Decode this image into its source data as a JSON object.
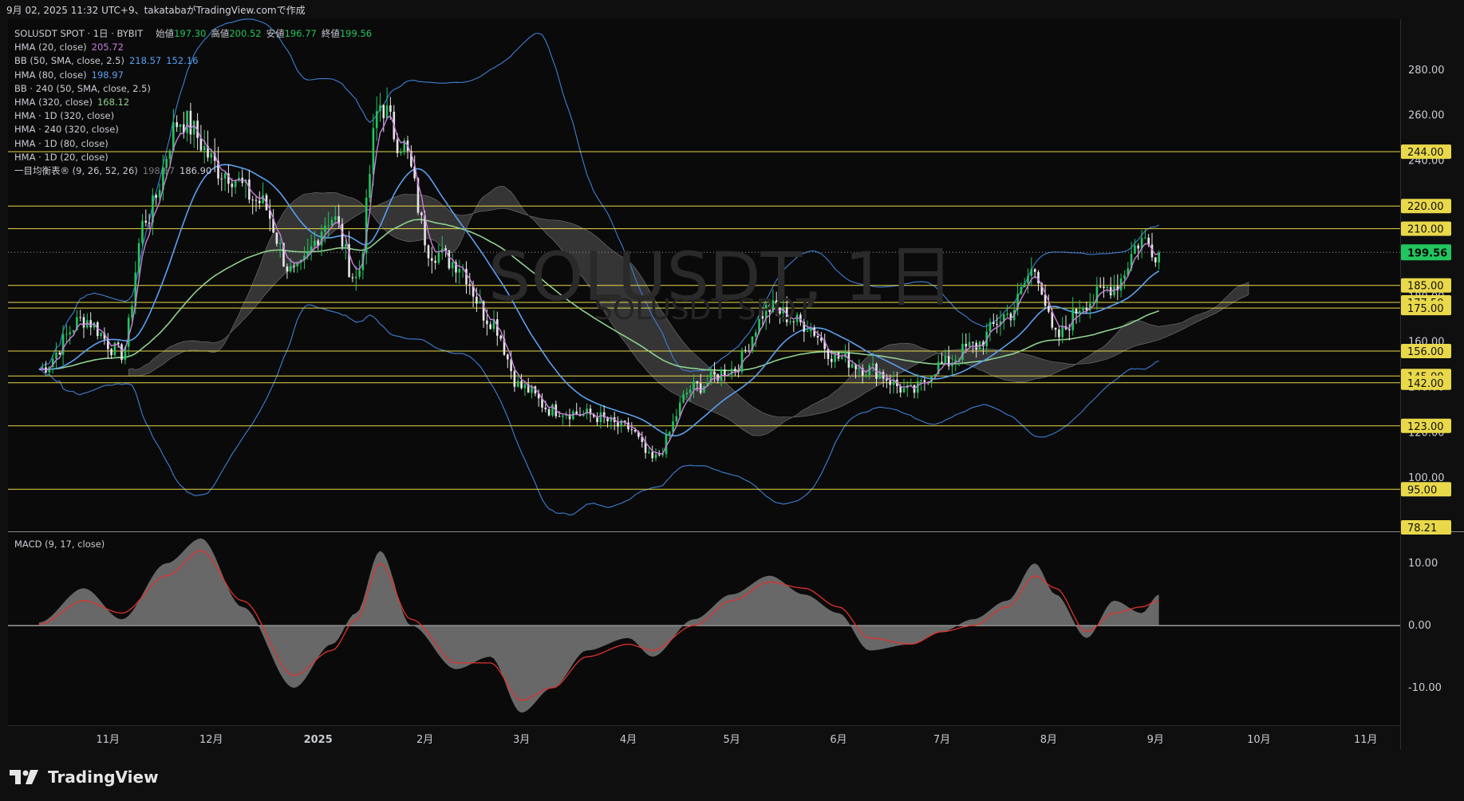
{
  "header": {
    "caption": "9月 02, 2025 11:32 UTC+9、takatabaがTradingView.comで作成"
  },
  "legend": {
    "symbol_line": "SOLUSDT SPOT · 1日 · BYBIT",
    "ohlc": {
      "open_label": "始値",
      "open": "197.30",
      "high_label": "高値",
      "high": "200.52",
      "low_label": "安値",
      "low": "196.77",
      "close_label": "終値",
      "close": "199.56"
    },
    "indicators": [
      {
        "label": "HMA (20, close)",
        "values": [
          "205.72"
        ],
        "colors": [
          "#c77ddb"
        ]
      },
      {
        "label": "BB (50, SMA, close, 2.5)",
        "values": [
          "218.57",
          "152.16"
        ],
        "colors": [
          "#5aa0f0",
          "#5aa0f0"
        ]
      },
      {
        "label": "HMA (80, close)",
        "values": [
          "198.97"
        ],
        "colors": [
          "#5aa0f0"
        ]
      },
      {
        "label": "BB · 240 (50, SMA, close, 2.5)",
        "values": [],
        "colors": []
      },
      {
        "label": "HMA (320, close)",
        "values": [
          "168.12"
        ],
        "colors": [
          "#8fd18f"
        ]
      },
      {
        "label": "HMA · 1D (320, close)",
        "values": [],
        "colors": []
      },
      {
        "label": "HMA · 240 (320, close)",
        "values": [],
        "colors": []
      },
      {
        "label": "HMA · 1D (80, close)",
        "values": [],
        "colors": []
      },
      {
        "label": "HMA · 1D (20, close)",
        "values": [],
        "colors": []
      },
      {
        "label": "一目均衡表® (9, 26, 52, 26)",
        "values": [
          "198.67",
          "186.90"
        ],
        "colors": [
          "#777777",
          "#c8cbd3"
        ]
      }
    ]
  },
  "watermark": {
    "line1": "SOLUSDT, 1日",
    "line2": "SOLUSDT SPOT"
  },
  "macd_title": "MACD (9, 17, close)",
  "brand": {
    "name": "TradingView"
  },
  "colors": {
    "up": "#22c55e",
    "down": "#e6e6e6",
    "hma20": "#c77ddb",
    "hma80": "#5aa0f0",
    "bb": "#3f7fd6",
    "hma320": "#8fd18f",
    "level": "#e8d84a",
    "cloud": "#6b6b6b",
    "signal": "#e0312f",
    "macd_fill": "#808080"
  },
  "chart_data": [
    {
      "type": "candlestick",
      "title": "SOLUSDT SPOT · 1日 · BYBIT",
      "x_ticks": [
        "11月",
        "12月",
        "2025",
        "2月",
        "3月",
        "4月",
        "5月",
        "6月",
        "7月",
        "8月",
        "9月",
        "10月",
        "11月"
      ],
      "y_ticks": [
        280,
        260,
        240,
        220,
        200,
        180,
        160,
        140,
        120,
        100
      ],
      "y_tick_labels": [
        "280.00",
        "260.00",
        "240.00",
        "220.00",
        "200.00",
        "180.00",
        "160.00",
        "140.00",
        "120.00",
        "100.00"
      ],
      "ylim": [
        78.21,
        300
      ],
      "last_price": "199.56",
      "horizontal_levels": [
        {
          "value": 244,
          "label": "244.00"
        },
        {
          "value": 220,
          "label": "220.00"
        },
        {
          "value": 210,
          "label": "210.00"
        },
        {
          "value": 185,
          "label": "185.00"
        },
        {
          "value": 177.5,
          "label": "177.50"
        },
        {
          "value": 175,
          "label": "175.00"
        },
        {
          "value": 156,
          "label": "156.00"
        },
        {
          "value": 145,
          "label": "145.00"
        },
        {
          "value": 142,
          "label": "142.00"
        },
        {
          "value": 123,
          "label": "123.00"
        },
        {
          "value": 95,
          "label": "95.00"
        },
        {
          "value": 78.21,
          "label": "78.21"
        }
      ],
      "close_series_anchors": {
        "x": [
          "10-12",
          "10-25",
          "11-05",
          "11-12",
          "11-22",
          "12-05",
          "12-15",
          "12-25",
          "01-05",
          "01-12",
          "01-19",
          "01-25",
          "02-03",
          "02-10",
          "02-20",
          "03-01",
          "03-10",
          "03-20",
          "04-01",
          "04-08",
          "04-20",
          "05-01",
          "05-12",
          "05-22",
          "06-01",
          "06-10",
          "06-22",
          "07-01",
          "07-10",
          "07-20",
          "07-28",
          "08-03",
          "08-12",
          "08-20",
          "08-28",
          "09-02"
        ],
        "y": [
          148,
          170,
          155,
          215,
          258,
          235,
          222,
          190,
          215,
          188,
          265,
          248,
          200,
          195,
          170,
          140,
          130,
          128,
          122,
          108,
          140,
          148,
          175,
          168,
          153,
          148,
          138,
          150,
          158,
          172,
          192,
          162,
          178,
          185,
          205,
          199.56
        ]
      },
      "series": [
        {
          "name": "HMA (20, close)",
          "last": 205.72
        },
        {
          "name": "BB (50, SMA, close, 2.5)",
          "upper_last": 218.57,
          "lower_last": 152.16
        },
        {
          "name": "HMA (80, close)",
          "last": 198.97
        },
        {
          "name": "HMA (320, close)",
          "last": 168.12
        },
        {
          "name": "一目均衡表® (9, 26, 52, 26)",
          "values": [
            198.67,
            186.9
          ]
        }
      ]
    },
    {
      "type": "area",
      "title": "MACD (9, 17, close)",
      "y_ticks": [
        10,
        0,
        -10
      ],
      "y_tick_labels": [
        "10.00",
        "0.00",
        "-10.00"
      ],
      "ylim": [
        -16,
        15
      ],
      "x": [
        "10-12",
        "10-25",
        "11-05",
        "11-18",
        "11-28",
        "12-10",
        "12-25",
        "01-05",
        "01-12",
        "01-19",
        "01-28",
        "02-10",
        "02-20",
        "03-01",
        "03-10",
        "03-20",
        "04-01",
        "04-08",
        "04-20",
        "05-01",
        "05-12",
        "05-22",
        "06-01",
        "06-10",
        "06-22",
        "07-01",
        "07-10",
        "07-20",
        "07-28",
        "08-03",
        "08-12",
        "08-20",
        "08-28",
        "09-02"
      ],
      "series": [
        {
          "name": "MACD",
          "values": [
            0.5,
            6,
            1,
            10,
            14,
            3,
            -10,
            -3,
            2,
            12,
            0,
            -7,
            -5,
            -14,
            -10,
            -4,
            -2,
            -5,
            1,
            5,
            8,
            5,
            2,
            -4,
            -3,
            -1,
            1,
            4,
            10,
            5,
            -2,
            4,
            2,
            5,
            4
          ]
        },
        {
          "name": "Signal",
          "values": [
            0.2,
            4,
            2,
            8,
            12,
            4,
            -8,
            -4,
            1,
            10,
            1,
            -6,
            -6,
            -12,
            -10,
            -5,
            -3,
            -4,
            0,
            4,
            7,
            6,
            3,
            -2,
            -3,
            -1,
            0,
            3,
            8,
            6,
            -1,
            2,
            3,
            4,
            3.5
          ]
        }
      ]
    }
  ]
}
